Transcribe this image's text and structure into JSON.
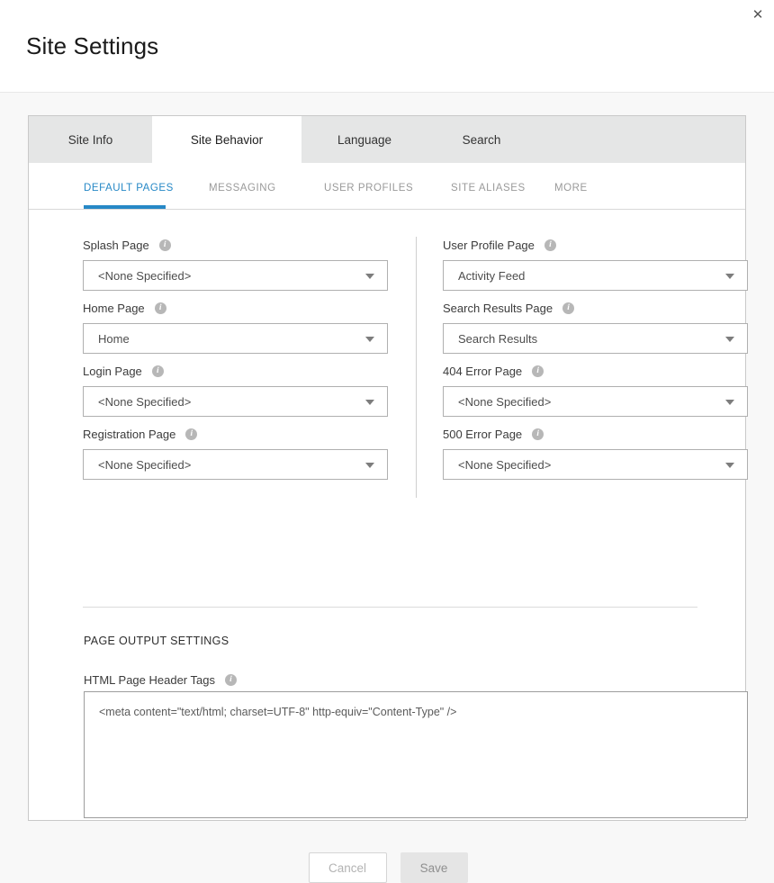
{
  "header": {
    "title": "Site Settings",
    "close_label": "✕"
  },
  "tabs": [
    {
      "label": "Site Info",
      "active": false
    },
    {
      "label": "Site Behavior",
      "active": true
    },
    {
      "label": "Language",
      "active": false
    },
    {
      "label": "Search",
      "active": false
    }
  ],
  "subtabs": [
    {
      "label": "DEFAULT PAGES",
      "active": true
    },
    {
      "label": "MESSAGING",
      "active": false
    },
    {
      "label": "USER PROFILES",
      "active": false
    },
    {
      "label": "SITE ALIASES",
      "active": false
    },
    {
      "label": "MORE",
      "active": false
    }
  ],
  "form": {
    "left_column": [
      {
        "label": "Splash Page",
        "value": "<None Specified>",
        "info": "i"
      },
      {
        "label": "Home Page",
        "value": "Home",
        "info": "i"
      },
      {
        "label": "Login Page",
        "value": "<None Specified>",
        "info": "i"
      },
      {
        "label": "Registration Page",
        "value": "<None Specified>",
        "info": "i"
      }
    ],
    "right_column": [
      {
        "label": "User Profile Page",
        "value": "Activity Feed",
        "info": "i"
      },
      {
        "label": "Search Results Page",
        "value": "Search Results",
        "info": "i"
      },
      {
        "label": "404 Error Page",
        "value": "<None Specified>",
        "info": "i"
      },
      {
        "label": "500 Error Page",
        "value": "<None Specified>",
        "info": "i"
      }
    ]
  },
  "page_output": {
    "section_heading": "PAGE OUTPUT SETTINGS",
    "textarea_label": "HTML Page Header Tags",
    "textarea_info": "i",
    "textarea_value": "<meta content=\"text/html; charset=UTF-8\" http-equiv=\"Content-Type\" />"
  },
  "footer": {
    "cancel_label": "Cancel",
    "save_label": "Save"
  },
  "colors": {
    "accent": "#2688c6",
    "tabstrip_bg": "#e5e6e6",
    "page_bg": "#f8f8f8",
    "panel_border": "#c9c9c9",
    "info_icon": "#b7b7b7"
  }
}
